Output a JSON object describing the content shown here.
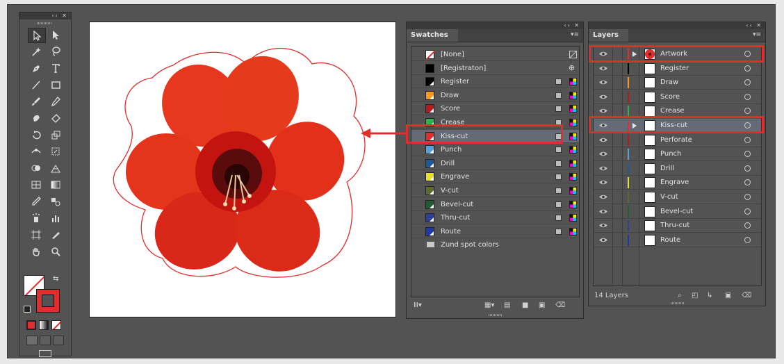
{
  "toolbox": {
    "collapse_icon": "double-chevron-icon",
    "close_icon": "close-icon",
    "tools": [
      "selection-tool-icon",
      "direct-selection-tool-icon",
      "magic-wand-tool-icon",
      "lasso-tool-icon",
      "pen-tool-icon",
      "type-tool-icon",
      "line-segment-tool-icon",
      "rectangle-tool-icon",
      "paintbrush-tool-icon",
      "pencil-tool-icon",
      "blob-brush-tool-icon",
      "eraser-tool-icon",
      "rotate-tool-icon",
      "scale-tool-icon",
      "width-tool-icon",
      "free-transform-tool-icon",
      "shape-builder-tool-icon",
      "perspective-grid-tool-icon",
      "mesh-tool-icon",
      "gradient-tool-icon",
      "eyedropper-tool-icon",
      "blend-tool-icon",
      "symbol-sprayer-tool-icon",
      "column-graph-tool-icon",
      "artboard-tool-icon",
      "slice-tool-icon",
      "hand-tool-icon",
      "zoom-tool-icon"
    ],
    "fill_stroke": {
      "fill": "none",
      "stroke": "#e12d2d"
    },
    "mode_buttons": [
      "color-mode-icon",
      "gradient-mode-icon",
      "none-mode-icon"
    ],
    "draw_modes": [
      "draw-normal-icon",
      "draw-behind-icon",
      "draw-inside-icon"
    ],
    "screen_mode": "screen-mode-icon"
  },
  "canvas": {
    "artwork_icon": "flower-icon",
    "cut_line_color": "#e12d2d",
    "arrow_color": "#e12d2d"
  },
  "swatches": {
    "tab_label": "Swatches",
    "header_controls": "‹‹ ✕",
    "menu_icon": "panel-menu-icon",
    "items": [
      {
        "label": "[None]",
        "color": "none",
        "selected": false,
        "icons": "none"
      },
      {
        "label": "[Registraton]",
        "color": "#000000",
        "selected": false,
        "icons": "registration"
      },
      {
        "label": "Register",
        "color": "#000000",
        "selected": false,
        "icons": "spot"
      },
      {
        "label": "Draw",
        "color": "#f39a1a",
        "selected": false,
        "icons": "spot"
      },
      {
        "label": "Score",
        "color": "#b21c1f",
        "selected": false,
        "icons": "spot"
      },
      {
        "label": "Crease",
        "color": "#2db34a",
        "selected": false,
        "icons": "spot"
      },
      {
        "label": "Kiss-cut",
        "color": "#e12d2d",
        "selected": true,
        "icons": "spot"
      },
      {
        "label": "Punch",
        "color": "#5aa0d8",
        "selected": false,
        "icons": "spot"
      },
      {
        "label": "Drill",
        "color": "#1c5a9c",
        "selected": false,
        "icons": "spot"
      },
      {
        "label": "Engrave",
        "color": "#e8e12a",
        "selected": false,
        "icons": "spot"
      },
      {
        "label": "V-cut",
        "color": "#5b6b2c",
        "selected": false,
        "icons": "spot"
      },
      {
        "label": "Bevel-cut",
        "color": "#1f5c31",
        "selected": false,
        "icons": "spot"
      },
      {
        "label": "Thru-cut",
        "color": "#2d3f98",
        "selected": false,
        "icons": "spot"
      },
      {
        "label": "Route",
        "color": "#1f3aa8",
        "selected": false,
        "icons": "spot"
      }
    ],
    "folder": {
      "label": "Zund spot colors",
      "icon": "folder-icon"
    },
    "footer_icons": [
      "swatch-libraries-icon",
      "show-swatch-kinds-icon",
      "swatch-options-icon",
      "new-color-group-icon",
      "new-swatch-icon",
      "delete-swatch-icon"
    ]
  },
  "layers": {
    "tab_label": "Layers",
    "header_controls": "‹‹ ✕",
    "menu_icon": "panel-menu-icon",
    "items": [
      {
        "label": "Artwork",
        "color": "#e12d2d",
        "selected": false,
        "expandable": true,
        "thumb": "flower"
      },
      {
        "label": "Register",
        "color": "#000000",
        "selected": false,
        "expandable": false,
        "thumb": "white"
      },
      {
        "label": "Draw",
        "color": "#f39a1a",
        "selected": false,
        "expandable": false,
        "thumb": "white"
      },
      {
        "label": "Score",
        "color": "#b21c1f",
        "selected": false,
        "expandable": false,
        "thumb": "white"
      },
      {
        "label": "Crease",
        "color": "#2db34a",
        "selected": false,
        "expandable": false,
        "thumb": "white"
      },
      {
        "label": "Kiss-cut",
        "color": "#e12d2d",
        "selected": true,
        "expandable": true,
        "thumb": "white"
      },
      {
        "label": "Perforate",
        "color": "#b21c1f",
        "selected": false,
        "expandable": false,
        "thumb": "white"
      },
      {
        "label": "Punch",
        "color": "#5aa0d8",
        "selected": false,
        "expandable": false,
        "thumb": "white"
      },
      {
        "label": "Drill",
        "color": "#1c5a9c",
        "selected": false,
        "expandable": false,
        "thumb": "white"
      },
      {
        "label": "Engrave",
        "color": "#e8e12a",
        "selected": false,
        "expandable": false,
        "thumb": "white"
      },
      {
        "label": "V-cut",
        "color": "#5b6b2c",
        "selected": false,
        "expandable": false,
        "thumb": "white"
      },
      {
        "label": "Bevel-cut",
        "color": "#1f5c31",
        "selected": false,
        "expandable": false,
        "thumb": "white"
      },
      {
        "label": "Thru-cut",
        "color": "#2d3f98",
        "selected": false,
        "expandable": false,
        "thumb": "white"
      },
      {
        "label": "Route",
        "color": "#1f3aa8",
        "selected": false,
        "expandable": false,
        "thumb": "white"
      }
    ],
    "footer_label": "14 Layers",
    "footer_icons": [
      "locate-object-icon",
      "make-clipping-mask-icon",
      "create-sublayer-icon",
      "create-layer-icon",
      "delete-layer-icon"
    ]
  }
}
